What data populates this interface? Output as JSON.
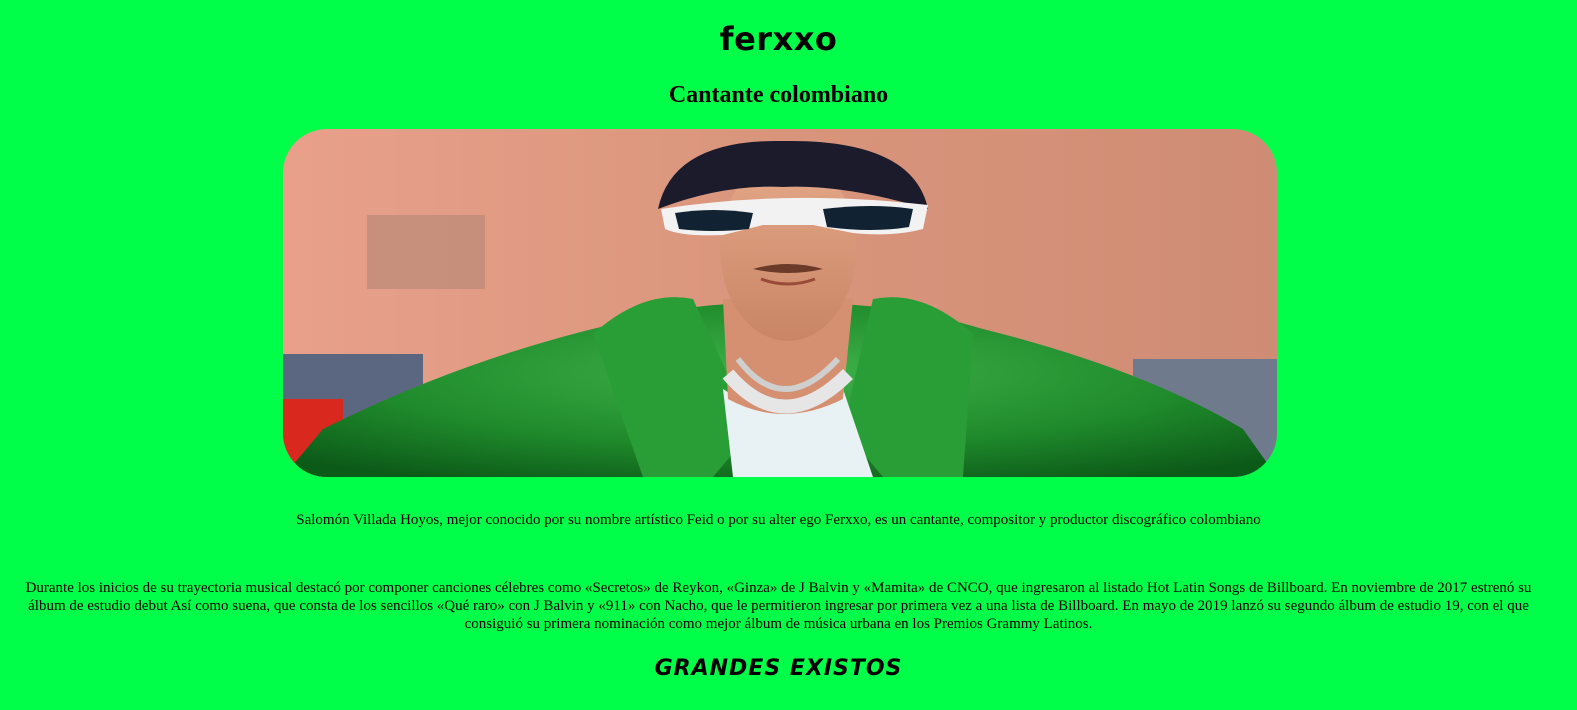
{
  "page": {
    "title": "ferxxo",
    "subtitle": "Cantante colombiano",
    "intro": "Salomón Villada Hoyos, mejor conocido por su nombre artístico Feid o por su alter ego Ferxxo,  es un cantante, compositor y productor discográfico colombiano",
    "bio": "Durante los inicios de su trayectoria musical destacó por componer canciones célebres como «Secretos» de Reykon, «Ginza» de J Balvin y «Mamita» de CNCO, que ingresaron al listado Hot Latin Songs de Billboard. En noviembre de 2017 estrenó su álbum de estudio debut Así como suena, que consta de los sencillos «Qué raro» con J Balvin y «911» con Nacho, que le permitieron ingresar por primera vez a una lista de Billboard. En mayo de 2019 lanzó su segundo álbum de estudio 19, con el que consiguió su primera nominación como mejor álbum de música urbana en los Premios Grammy Latinos.",
    "section_heading": "GRANDES EXISTOS"
  },
  "colors": {
    "background": "#00ff48",
    "text": "#000000"
  }
}
